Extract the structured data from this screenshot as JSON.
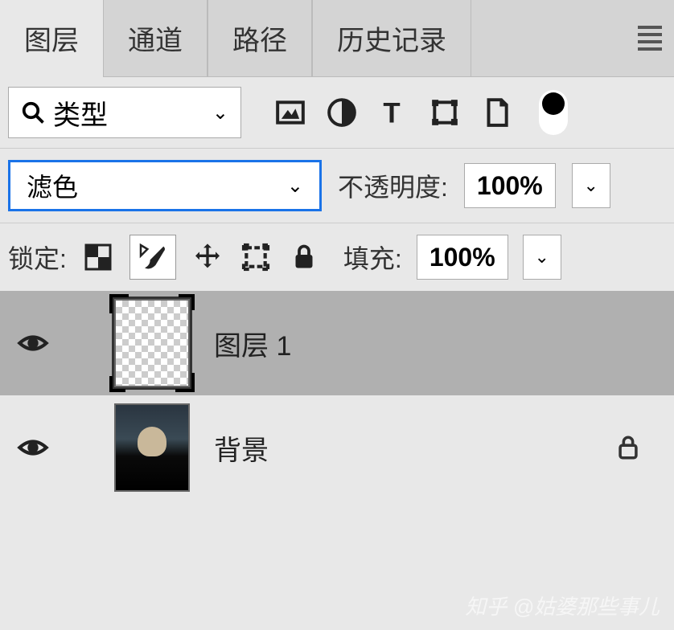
{
  "tabs": {
    "layers": "图层",
    "channels": "通道",
    "paths": "路径",
    "history": "历史记录"
  },
  "filter": {
    "search_label": "类型"
  },
  "blend": {
    "mode": "滤色",
    "opacity_label": "不透明度:",
    "opacity_value": "100%"
  },
  "lock": {
    "label": "锁定:",
    "fill_label": "填充:",
    "fill_value": "100%"
  },
  "layers": [
    {
      "name": "图层 1",
      "locked": false,
      "selected": true
    },
    {
      "name": "背景",
      "locked": true,
      "selected": false
    }
  ],
  "watermark": "知乎 @姑婆那些事儿"
}
